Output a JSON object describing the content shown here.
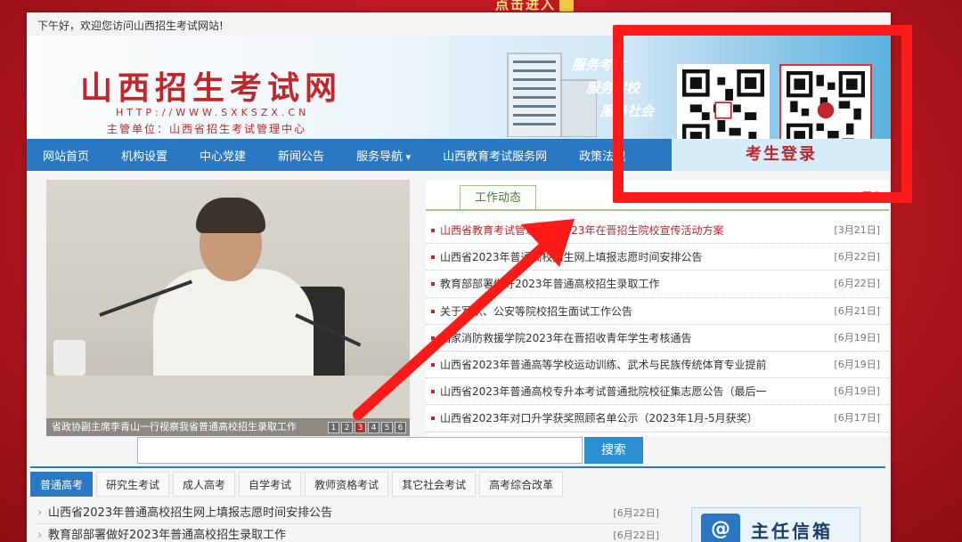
{
  "banner": {
    "text": "点击进入"
  },
  "greeting": "下午好，欢迎您访问山西招生考试网站!",
  "header": {
    "title": "山西招生考试网",
    "url": "HTTP://WWW.SXKSZX.CN",
    "org": "主管单位：山西省招生考试管理中心",
    "slogans": [
      "服务考生",
      "服务学校",
      "服务社会"
    ]
  },
  "nav": {
    "items": [
      "网站首页",
      "机构设置",
      "中心党建",
      "新闻公告",
      "服务导航",
      "山西教育考试服务网",
      "政策法规"
    ],
    "login": "考生登录"
  },
  "photo": {
    "caption": "省政协副主席李青山一行视察我省普通高校招生录取工作",
    "pages": [
      "1",
      "2",
      "3",
      "4",
      "5",
      "6"
    ]
  },
  "news": {
    "tab": "工作动态",
    "more": "更多",
    "items": [
      {
        "title": "山西省教育考试管理中心2023年在晋招生院校宣传活动方案",
        "date": "[3月21日]",
        "highlight": true
      },
      {
        "title": "山西省2023年普通高校招生网上填报志愿时间安排公告",
        "date": "[6月22日]"
      },
      {
        "title": "教育部部署做好2023年普通高校招生录取工作",
        "date": "[6月22日]"
      },
      {
        "title": "关于军队、公安等院校招生面试工作公告",
        "date": "[6月21日]"
      },
      {
        "title": "国家消防救援学院2023年在晋招收青年学生考核通告",
        "date": "[6月19日]"
      },
      {
        "title": "山西省2023年普通高等学校运动训练、武术与民族传统体育专业提前",
        "date": "[6月19日]"
      },
      {
        "title": "山西省2023年普通高校专升本考试普通批院校征集志愿公告（最后一",
        "date": "[6月19日]"
      },
      {
        "title": "山西省2023年对口升学获奖照顾名单公示（2023年1月-5月获奖）",
        "date": "[6月17日]"
      }
    ]
  },
  "search": {
    "button": "搜索",
    "placeholder": ""
  },
  "tabs": [
    "普通高考",
    "研究生考试",
    "成人高考",
    "自学考试",
    "教师资格考试",
    "其它社会考试",
    "高考综合改革"
  ],
  "bottom_news": [
    {
      "title": "山西省2023年普通高校招生网上填报志愿时间安排公告",
      "date": "[6月22日]"
    },
    {
      "title": "教育部部署做好2023年普通高校招生录取工作",
      "date": "[6月22日]"
    }
  ],
  "mailbox": {
    "icon": "@",
    "label": "主任信箱"
  },
  "colors": {
    "accent": "#2a78c2",
    "brand": "#c0262a",
    "frame": "#ff1a1a"
  }
}
